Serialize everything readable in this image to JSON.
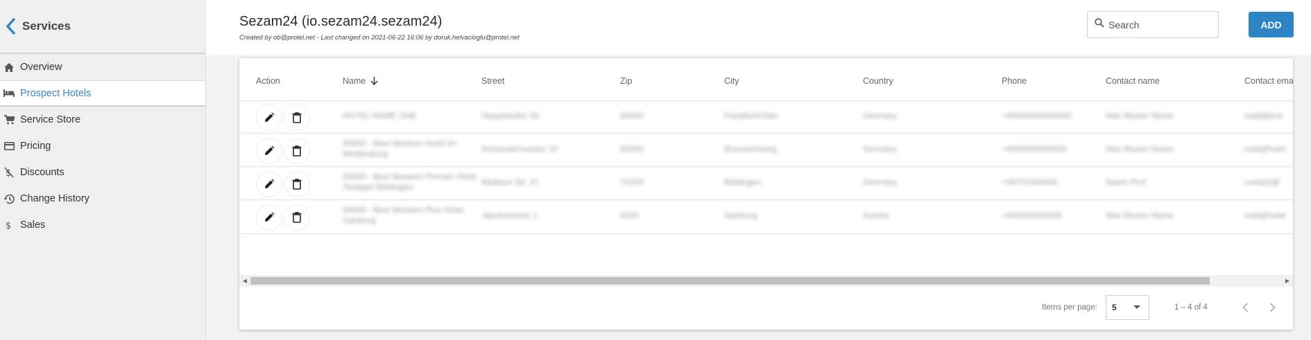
{
  "sidebar": {
    "title": "Services",
    "items": [
      {
        "label": "Overview",
        "icon": "home-icon",
        "active": false
      },
      {
        "label": "Prospect Hotels",
        "icon": "bed-icon",
        "active": true
      },
      {
        "label": "Service Store",
        "icon": "cart-icon",
        "active": false
      },
      {
        "label": "Pricing",
        "icon": "credit-card-icon",
        "active": false
      },
      {
        "label": "Discounts",
        "icon": "discount-icon",
        "active": false
      },
      {
        "label": "Change History",
        "icon": "history-icon",
        "active": false
      },
      {
        "label": "Sales",
        "icon": "dollar-icon",
        "active": false
      }
    ]
  },
  "header": {
    "title": "Sezam24 (io.sezam24.sezam24)",
    "subtitle": "Created by ob@protel.net - Last changed on 2021-06-22 16:06 by doruk.helvacioglu@protel.net",
    "search_placeholder": "Search",
    "add_label": "ADD"
  },
  "table": {
    "columns": [
      "Action",
      "Name",
      "Street",
      "Zip",
      "City",
      "Country",
      "Phone",
      "Contact name",
      "Contact ema"
    ],
    "rows": [
      {
        "name": "HOTEL NAME ONE",
        "street": "Hauptstraße 19",
        "zip": "00000",
        "city": "Frankfurt/Oder",
        "country": "Germany",
        "phone": "+49000000000000",
        "contact": "Max Muster Name",
        "email": "mail@prot"
      },
      {
        "name": "00000 - Best Western Hotel Im Weißenburg",
        "street": "Schneidermeister 10",
        "zip": "00000",
        "city": "Braunschweig",
        "country": "Germany",
        "phone": "+4900000000000",
        "contact": "Max Muster Name",
        "email": "mail@hotel"
      },
      {
        "name": "00000 - Best Western Premier Hotel Stuttgart Böblingen",
        "street": "Wallison Str. 37",
        "zip": "71034",
        "city": "Böblingen",
        "country": "Germany",
        "phone": "+49701000000",
        "contact": "Name Prof",
        "email": "contact@"
      },
      {
        "name": "00000 - Best Western Plus Hotel Salzburg",
        "street": "Jakobstrasse 1",
        "zip": "5020",
        "city": "Salzburg",
        "country": "Austria",
        "phone": "+430000000000",
        "contact": "Max Muster Name",
        "email": "mail@hotel"
      }
    ]
  },
  "pagination": {
    "items_per_page_label": "Items per page:",
    "items_per_page_value": "5",
    "range": "1 – 4 of 4"
  },
  "colors": {
    "accent": "#2f84c4",
    "active_nav": "#3b86c7",
    "sidebar_bg": "#efefef"
  }
}
